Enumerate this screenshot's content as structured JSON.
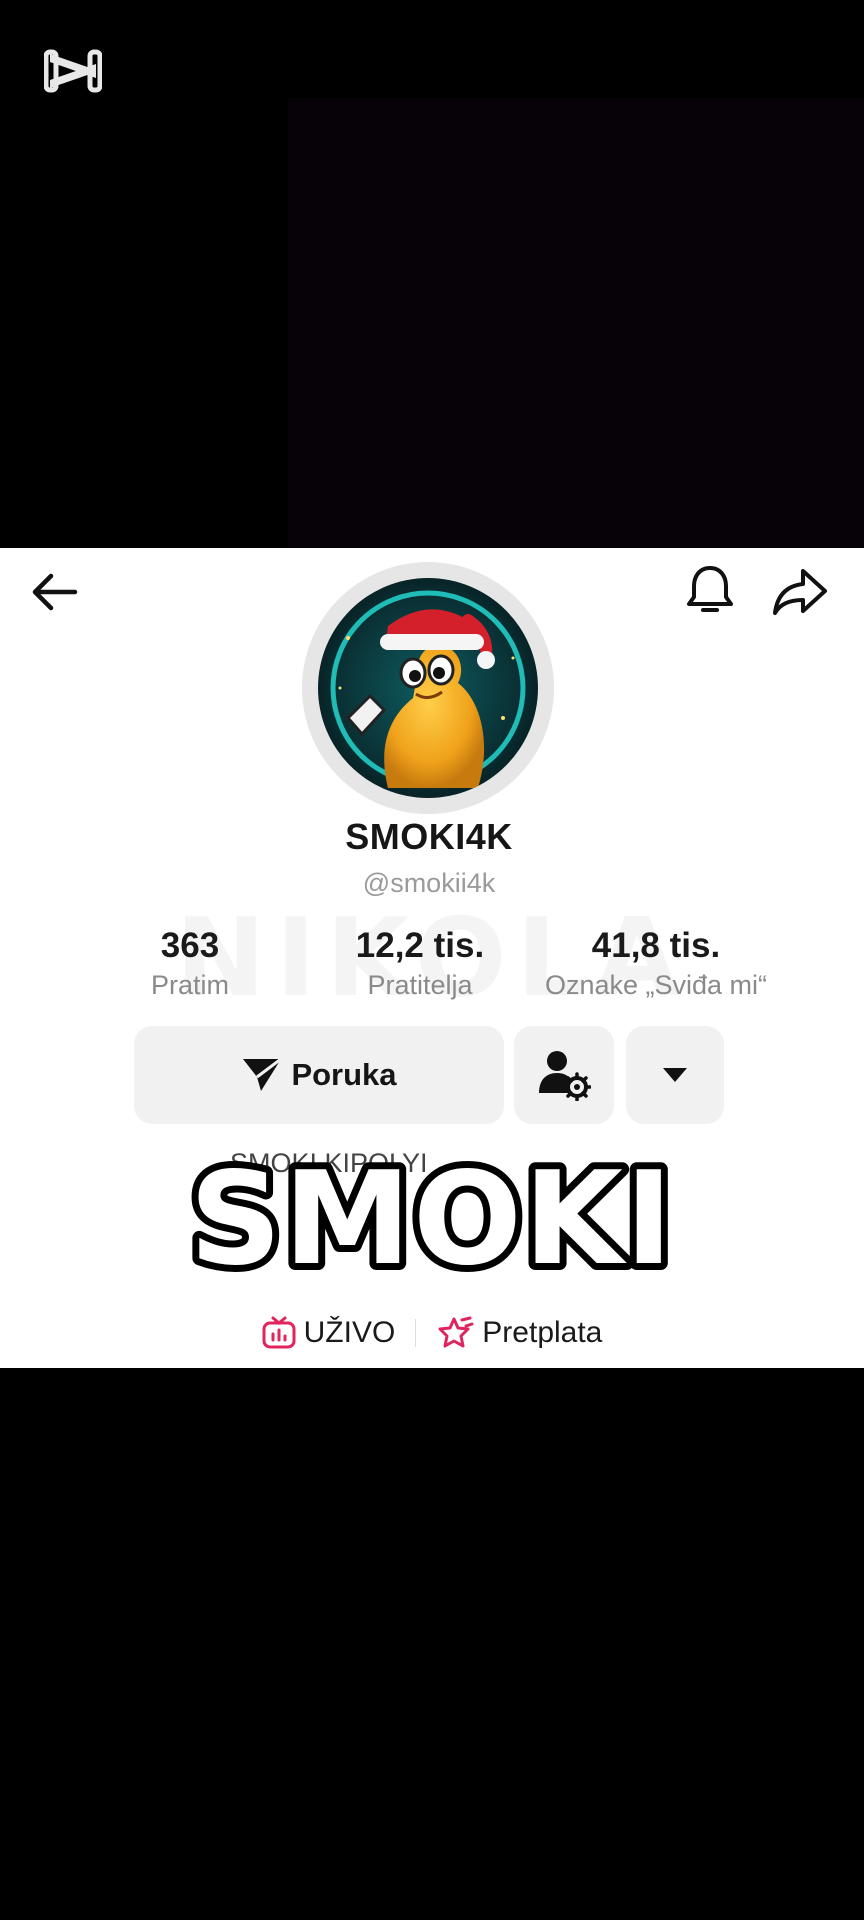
{
  "app": {
    "logo_icon": "capcut-logo-icon"
  },
  "toolbar": {
    "back_icon": "arrow-left-icon",
    "bell_icon": "bell-icon",
    "share_icon": "share-arrow-icon"
  },
  "profile": {
    "display_name": "SMOKI4K",
    "handle": "@smokii4k",
    "watermark": "NIKOLA",
    "stats": [
      {
        "value": "363",
        "label": "Pratim"
      },
      {
        "value": "12,2 tis.",
        "label": "Pratitelja"
      },
      {
        "value": "41,8 tis.",
        "label": "Oznake „Sviđa mi“"
      }
    ],
    "actions": {
      "message_label": "Poruka",
      "message_icon": "send-icon",
      "user_settings_icon": "user-gear-icon",
      "more_icon": "caret-down-icon"
    },
    "bio_partial": "SMOKI KIPOLYI",
    "links": [
      {
        "label": "UŽIVO",
        "icon": "live-tv-icon"
      },
      {
        "label": "Pretplata",
        "icon": "subscription-star-icon"
      }
    ]
  },
  "overlay": {
    "caption": "SMOKI"
  },
  "colors": {
    "panel_bg": "#ffffff",
    "button_bg": "#f1f1f1",
    "link_accent": "#e0245e",
    "text_primary": "#161616",
    "text_secondary": "#8a8a8a"
  }
}
